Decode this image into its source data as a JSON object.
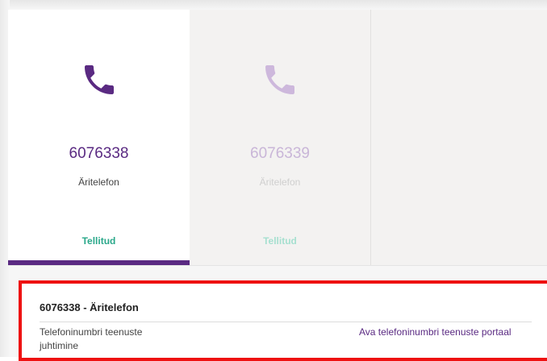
{
  "colors": {
    "brand_purple": "#5a2a82",
    "status_green": "#2aa88a",
    "highlight_red": "#ee1111"
  },
  "cards": [
    {
      "icon": "phone-icon",
      "number": "6076338",
      "type": "Äritelefon",
      "status": "Tellitud",
      "selected": true
    },
    {
      "icon": "phone-icon",
      "number": "6076339",
      "type": "Äritelefon",
      "status": "Tellitud",
      "selected": false
    }
  ],
  "detail": {
    "title": "6076338 - Äritelefon",
    "manage_label": "Telefoninumbri teenuste juhtimine",
    "portal_link": "Ava telefoninumbri teenuste portaal"
  }
}
